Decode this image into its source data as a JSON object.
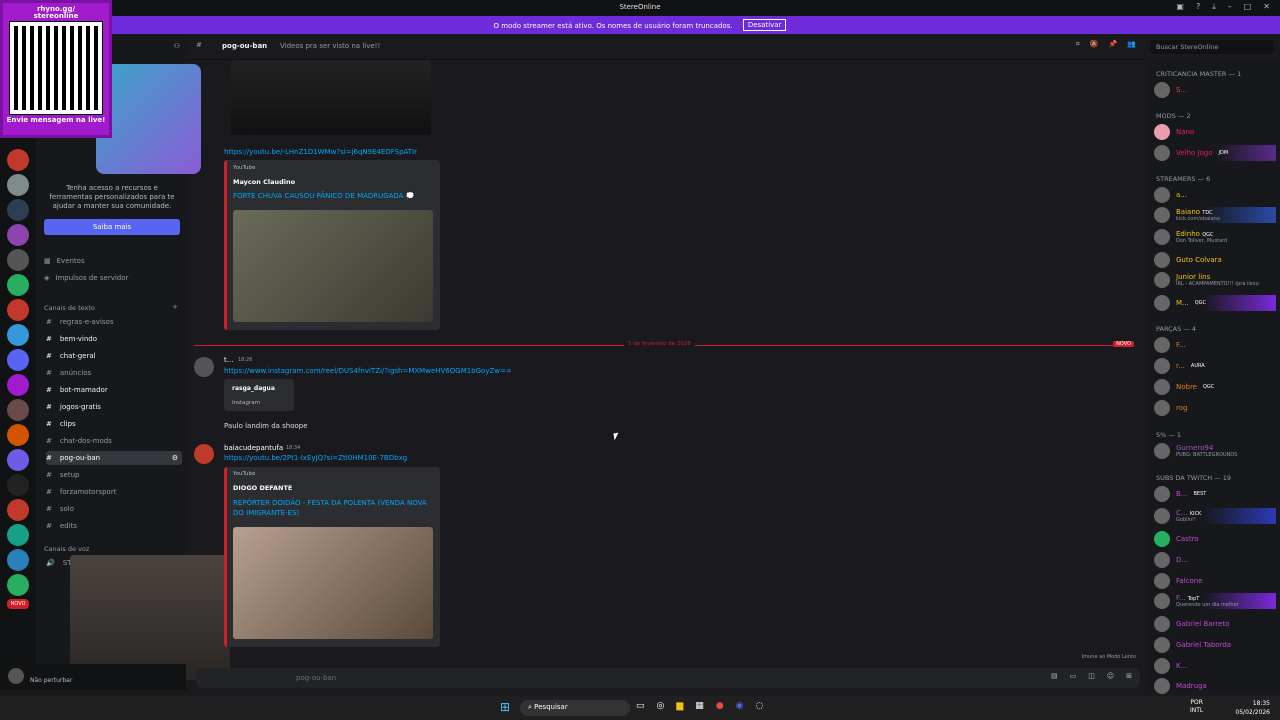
{
  "window": {
    "title": "StereOnline"
  },
  "banner": {
    "message": "O modo streamer está ativo. Os nomes de usuário foram truncados.",
    "button": "Desativar"
  },
  "overlay": {
    "qr_title_1": "rhyno.gg/",
    "qr_title_2": "stereonline",
    "qr_footer": "Envie mensagem na live!"
  },
  "sidebar": {
    "promo_text": "Tenha acesso a recursos e ferramentas personalizados para te ajudar a manter sua comunidade.",
    "promo_button": "Saiba mais",
    "events": "Eventos",
    "boosts": "Impulsos de servidor",
    "text_category": "Canais de texto",
    "voice_category": "Canais de voz",
    "channels": [
      {
        "name": "regras-e-avisos"
      },
      {
        "name": "bem-vindo"
      },
      {
        "name": "chat-geral"
      },
      {
        "name": "anúncios"
      },
      {
        "name": "bot-mamador"
      },
      {
        "name": "jogos-gratis"
      },
      {
        "name": "clips"
      },
      {
        "name": "chat-dos-mods"
      },
      {
        "name": "pog-ou-ban"
      },
      {
        "name": "setup"
      },
      {
        "name": "forzamotorsport"
      },
      {
        "name": "solo"
      },
      {
        "name": "edits"
      }
    ],
    "voice_channel": "STREAM",
    "user_status": "Não perturbar",
    "new_badge": "NOVO"
  },
  "header": {
    "channel": "pog-ou-ban",
    "topic": "Videos pra ser visto na live!!"
  },
  "search": {
    "placeholder": "Buscar StereOnline"
  },
  "chat": {
    "link1": "https://youtu.be/-LHnZ1D1WMw?si=j6qN9E4EDFSpATIr",
    "embed1_provider": "YouTube",
    "embed1_author": "Maycon Claudino",
    "embed1_title": "FORTE CHUVA CAUSOU PÂNICO DE MADRUGADA 💭",
    "divider_date": "5 de fevereiro de 2026",
    "divider_new": "NOVO",
    "msg2_author": "t...",
    "msg2_time": "18:26",
    "msg2_link": "https://www.instagram.com/reel/DUS4fnviTZi/?igsh=MXMweHV6OGM1bGoyZw==",
    "msg2_embed_name": "rasga_dagua",
    "msg2_embed_source": "Instagram",
    "msg2_text": "Paulo landim da shoope",
    "msg3_author": "baiacudepantufa",
    "msg3_time": "18:34",
    "msg3_link": "https://youtu.be/2Pt1-lxEyJQ?si=ZtI0HM10E-7BDbxg",
    "embed3_provider": "YouTube",
    "embed3_author": "DIOGO DEFANTE",
    "embed3_title": "REPÓRTER DOIDÃO - FESTA DA POLENTA (VENDA NOVA DO IMIGRANTE-ES)",
    "slow_mode": "Imune ao Modo Lento",
    "composer_placeholder": "pog-ou-ban"
  },
  "members": {
    "groups": [
      {
        "label": "CRITICANCIA MASTER — 1"
      },
      {
        "label": "MODS — 2"
      },
      {
        "label": "STREAMERS — 6"
      },
      {
        "label": "PARÇAS — 4"
      },
      {
        "label": "S% — 1"
      },
      {
        "label": "SUBS DA TWITCH — 19"
      }
    ],
    "list": [
      {
        "name": "S...",
        "sub": "",
        "color": "#e74c3c"
      },
      {
        "name": "Nano",
        "sub": "",
        "color": "#e91e63"
      },
      {
        "name": "Velho Jogo",
        "sub": "",
        "color": "#e91e63"
      },
      {
        "name": "a...",
        "sub": "",
        "color": "#f1c40f"
      },
      {
        "name": "Baiano",
        "sub": "kick.com/obaiano",
        "color": "#f1c40f"
      },
      {
        "name": "Edinho",
        "sub": "Don Toliver, Mustard",
        "color": "#f1c40f"
      },
      {
        "name": "Guto Colvara",
        "sub": "",
        "color": "#f1c40f"
      },
      {
        "name": "Junior lins",
        "sub": "IRL - ACAMPAMENTO!!! (pra ilesu",
        "color": "#f1c40f"
      },
      {
        "name": "M...",
        "sub": "",
        "color": "#f1c40f"
      },
      {
        "name": "F...",
        "sub": "",
        "color": "#e67e22"
      },
      {
        "name": "r...",
        "sub": "",
        "color": "#e67e22"
      },
      {
        "name": "Nobre",
        "sub": "",
        "color": "#e67e22"
      },
      {
        "name": "rog",
        "sub": "",
        "color": "#e67e22"
      },
      {
        "name": "Gurnero94",
        "sub": "PUBG: BATTLEGROUNDS",
        "color": "#9b59b6"
      },
      {
        "name": "B...",
        "sub": "",
        "color": "#c04bd6"
      },
      {
        "name": "C...",
        "sub": "Goblin!!",
        "color": "#c04bd6"
      },
      {
        "name": "Castro",
        "sub": "",
        "color": "#c04bd6"
      },
      {
        "name": "D...",
        "sub": "",
        "color": "#c04bd6"
      },
      {
        "name": "Falcone",
        "sub": "",
        "color": "#c04bd6"
      },
      {
        "name": "F...",
        "sub": "Querendo um dia melhor",
        "color": "#c04bd6"
      },
      {
        "name": "Gabriel Barreto",
        "sub": "",
        "color": "#c04bd6"
      },
      {
        "name": "Gabriel Taborda",
        "sub": "",
        "color": "#c04bd6"
      },
      {
        "name": "K...",
        "sub": "",
        "color": "#c04bd6"
      },
      {
        "name": "Madruga",
        "sub": "",
        "color": "#c04bd6"
      }
    ],
    "tags": {
      "jdm": "JDM",
      "tdc": "TDC",
      "qgc": "QGC",
      "aura": "AURA",
      "best": "BEST",
      "kick": "KICK",
      "topt": "TopT"
    }
  },
  "taskbar": {
    "search": "Pesquisar",
    "lang": "POR",
    "layout": "INTL",
    "time": "18:35",
    "date": "05/02/2026"
  },
  "colors": {
    "accent": "#5865f2",
    "banner": "#6d2bd9",
    "link": "#00a8fc",
    "new": "#d11f2a"
  }
}
